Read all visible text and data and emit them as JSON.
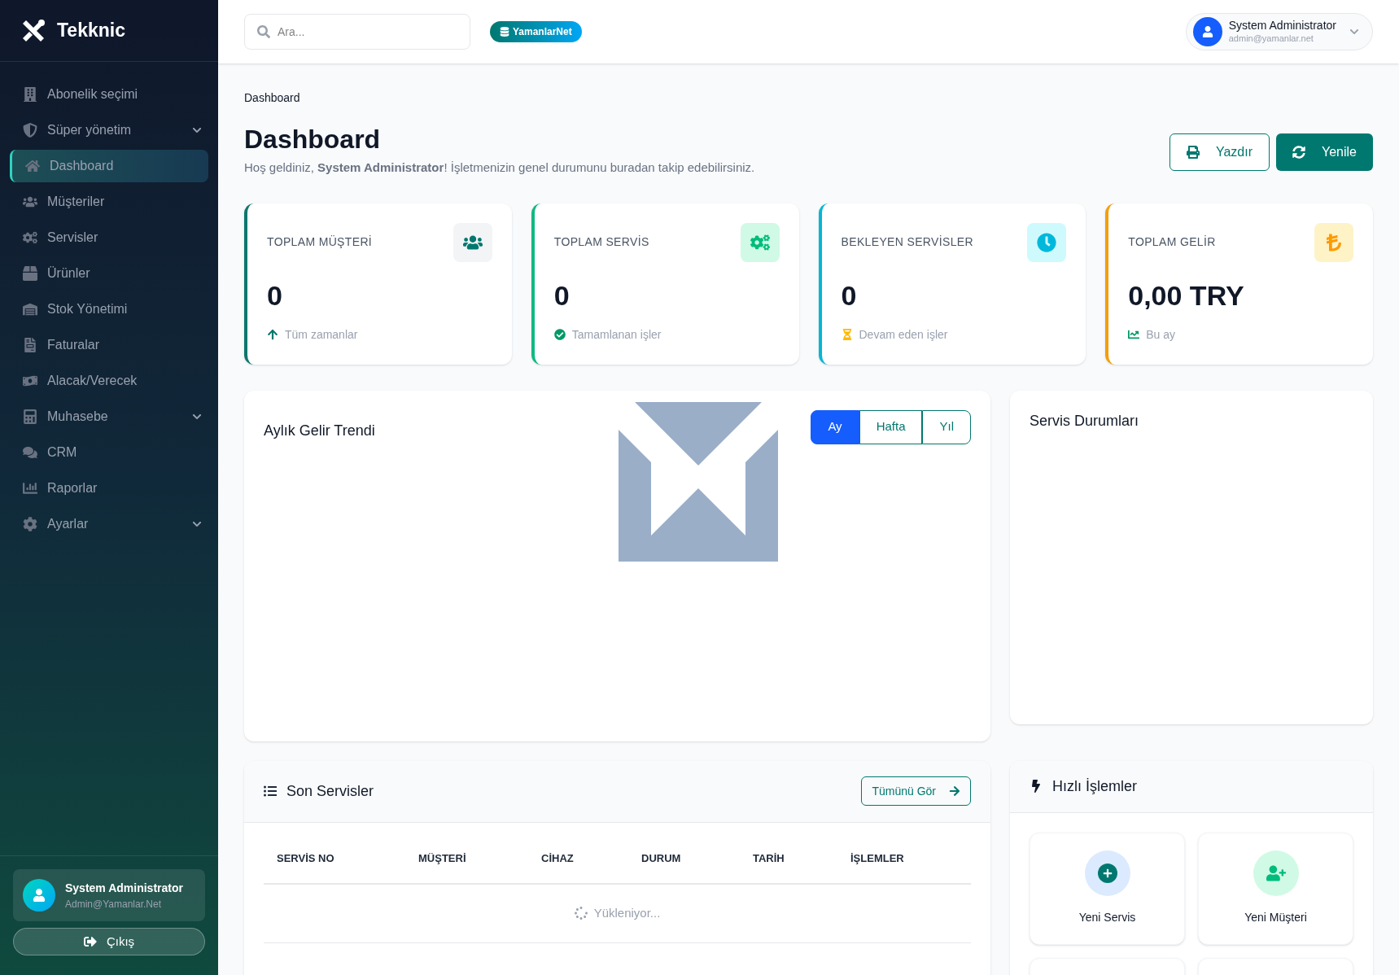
{
  "brand": {
    "name": "Tekknic"
  },
  "sidebar": {
    "items": [
      {
        "label": "Abonelik seçimi",
        "selected": false,
        "expandable": false
      },
      {
        "label": "Süper yönetim",
        "selected": false,
        "expandable": true
      },
      {
        "label": "Dashboard",
        "selected": true,
        "expandable": false
      },
      {
        "label": "Müşteriler",
        "selected": false,
        "expandable": false
      },
      {
        "label": "Servisler",
        "selected": false,
        "expandable": false
      },
      {
        "label": "Ürünler",
        "selected": false,
        "expandable": false
      },
      {
        "label": "Stok Yönetimi",
        "selected": false,
        "expandable": false
      },
      {
        "label": "Faturalar",
        "selected": false,
        "expandable": false
      },
      {
        "label": "Alacak/Verecek",
        "selected": false,
        "expandable": false
      },
      {
        "label": "Muhasebe",
        "selected": false,
        "expandable": true
      },
      {
        "label": "CRM",
        "selected": false,
        "expandable": false
      },
      {
        "label": "Raporlar",
        "selected": false,
        "expandable": false
      },
      {
        "label": "Ayarlar",
        "selected": false,
        "expandable": true
      }
    ],
    "user": {
      "name": "System Administrator",
      "email": "Admin@Yamanlar.Net"
    },
    "logout": "Çıkış"
  },
  "topbar": {
    "search": {
      "placeholder": "Ara..."
    },
    "tenant_badge": "YamanlarNet",
    "user": {
      "name": "System Administrator",
      "email": "admin@yamanlar.net"
    }
  },
  "breadcrumb": "Dashboard",
  "page": {
    "title": "Dashboard",
    "subtitle": "Hoş geldiniz, **System Administrator**! İşletmenizin genel durumunu buradan takip edebilirsiniz.",
    "buttons": [
      "Yazdır",
      "Yenile"
    ]
  },
  "stats": [
    {
      "label": "TOPLAM MÜŞTERİ",
      "value": "0",
      "note": "Tüm zamanlar",
      "color": "#0f766e"
    },
    {
      "label": "TOPLAM SERVİS",
      "value": "0",
      "note": "Tamamlanan işler",
      "color": "#10b981"
    },
    {
      "label": "BEKLEYEN SERVİSLER",
      "value": "0",
      "note": "Devam eden işler",
      "color": "#06b6d4"
    },
    {
      "label": "TOPLAM GELİR",
      "value": "0,00 TRY",
      "note": "Bu ay",
      "color": "#f59e0b"
    }
  ],
  "revenue_chart": {
    "title": "Aylık Gelir Trendi",
    "periods": [
      {
        "label": "Ay",
        "selected": true
      },
      {
        "label": "Hafta",
        "selected": false
      },
      {
        "label": "Yıl",
        "selected": false
      }
    ]
  },
  "service_status": {
    "title": "Servis Durumları"
  },
  "recent_services": {
    "title": "Son Servisler",
    "view_all": "Tümünü Gör",
    "columns": [
      "SERVİS NO",
      "MÜŞTERİ",
      "CİHAZ",
      "DURUM",
      "TARİH",
      "İŞLEMLER"
    ],
    "loading": "Yükleniyor..."
  },
  "quick_actions": {
    "title": "Hızlı İşlemler",
    "items": [
      {
        "label": "Yeni Servis"
      },
      {
        "label": "Yeni Müşteri"
      }
    ]
  }
}
